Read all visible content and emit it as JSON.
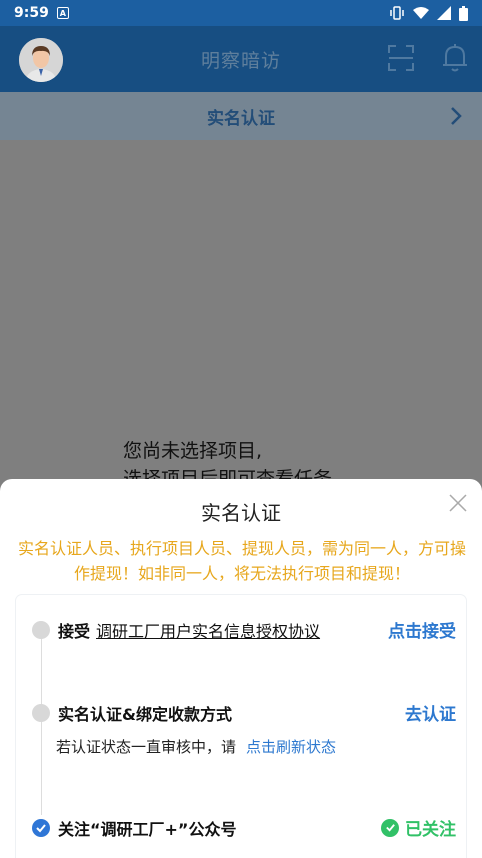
{
  "status_bar": {
    "time": "9:59",
    "app_icon_letter": "A"
  },
  "header": {
    "title": "明察暗访",
    "icons": [
      "avatar",
      "scan-icon",
      "bell-icon"
    ]
  },
  "realname_bar": {
    "label": "实名认证"
  },
  "main": {
    "empty_line1": "您尚未选择项目,",
    "empty_line2": "选择项目后即可查看任务"
  },
  "sheet": {
    "title": "实名认证",
    "notice": "实名认证人员、执行项目人员、提现人员，需为同一人，方可操作提现！如非同一人，将无法执行项目和提现！",
    "step1": {
      "prefix": "接受",
      "link": "调研工厂用户实名信息授权协议",
      "action": "点击接受"
    },
    "step2": {
      "label": "实名认证&绑定收款方式",
      "action": "去认证",
      "sub": "若认证状态一直审核中，请",
      "sub_link": "点击刷新状态"
    },
    "step3": {
      "label": "关注“调研工厂+”公众号",
      "status": "已关注"
    }
  },
  "colors": {
    "primary": "#174e82",
    "accent": "#2d78cf",
    "warning": "#e7a71d",
    "success": "#31c167"
  }
}
